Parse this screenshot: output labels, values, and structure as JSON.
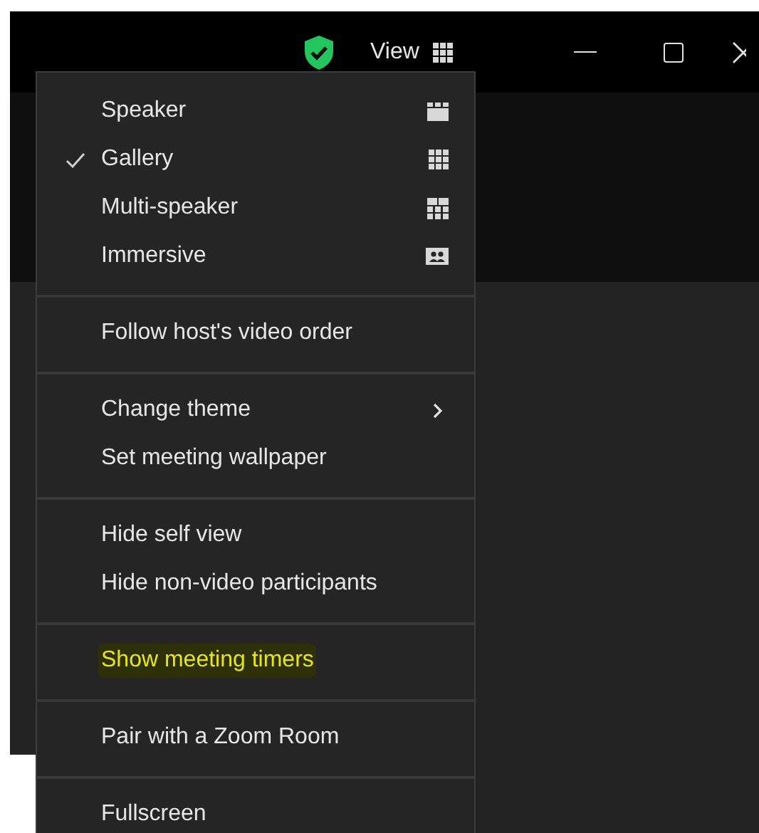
{
  "title_bar": {
    "view_label": "View"
  },
  "view_menu": {
    "sections": [
      {
        "items": [
          {
            "label": "Speaker",
            "checked": false,
            "kind": "speaker",
            "submenu": false,
            "highlighted": false
          },
          {
            "label": "Gallery",
            "checked": true,
            "kind": "gallery",
            "submenu": false,
            "highlighted": false
          },
          {
            "label": "Multi-speaker",
            "checked": false,
            "kind": "multi",
            "submenu": false,
            "highlighted": false
          },
          {
            "label": "Immersive",
            "checked": false,
            "kind": "immersive",
            "submenu": false,
            "highlighted": false
          }
        ]
      },
      {
        "items": [
          {
            "label": "Follow host's video order",
            "checked": false,
            "kind": "plain",
            "submenu": false,
            "highlighted": false
          }
        ]
      },
      {
        "items": [
          {
            "label": "Change theme",
            "checked": false,
            "kind": "plain",
            "submenu": true,
            "highlighted": false
          },
          {
            "label": "Set meeting wallpaper",
            "checked": false,
            "kind": "plain",
            "submenu": false,
            "highlighted": false
          }
        ]
      },
      {
        "items": [
          {
            "label": "Hide self view",
            "checked": false,
            "kind": "plain",
            "submenu": false,
            "highlighted": false
          },
          {
            "label": "Hide non-video participants",
            "checked": false,
            "kind": "plain",
            "submenu": false,
            "highlighted": false
          }
        ]
      },
      {
        "items": [
          {
            "label": "Show meeting timers",
            "checked": false,
            "kind": "plain",
            "submenu": false,
            "highlighted": true
          }
        ]
      },
      {
        "items": [
          {
            "label": "Pair with a Zoom Room",
            "checked": false,
            "kind": "plain",
            "submenu": false,
            "highlighted": false
          }
        ]
      },
      {
        "items": [
          {
            "label": "Fullscreen",
            "checked": false,
            "kind": "plain",
            "submenu": false,
            "highlighted": false
          }
        ]
      }
    ]
  }
}
